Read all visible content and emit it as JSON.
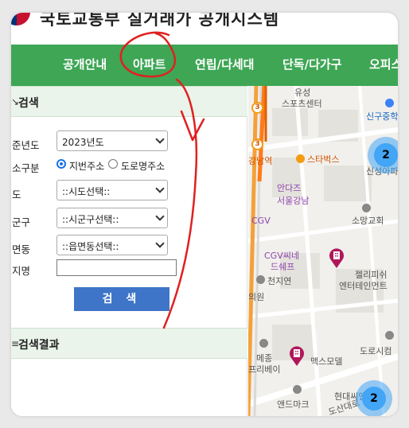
{
  "header": {
    "site_title": "국토교통부 실거래가 공개시스템"
  },
  "nav": {
    "items": [
      {
        "label": "공개안내"
      },
      {
        "label": "아파트"
      },
      {
        "label": "연립/다세대"
      },
      {
        "label": "단독/다가구"
      },
      {
        "label": "오피스"
      }
    ]
  },
  "search_panel": {
    "title": "검색",
    "year_label": "준년도",
    "year_value": "2023년도",
    "type_label": "소구분",
    "radio_lot": "지번주소",
    "radio_road": "도로명주소",
    "sido_label": "도",
    "sido_value": "::시도선택::",
    "sigungu_label": "군구",
    "sigungu_value": "::시군구선택::",
    "dong_label": "면동",
    "dong_value": "::읍면동선택::",
    "name_label": "지명",
    "name_value": "",
    "button": "검 색"
  },
  "results": {
    "title": "검색결과"
  },
  "map": {
    "labels": {
      "yuseong": "유성",
      "sports": "스포츠센터",
      "singu": "신구중학",
      "gangnam": "강남역",
      "starbucks": "스타벅스",
      "sinseong": "신성아파트",
      "antarctic1": "안다즈",
      "antarctic2": "서울강남",
      "somang": "소망교회",
      "cgv": "CGV",
      "cgv2a": "CGV씨네",
      "cgv2b": "드쉐프",
      "cheonjiyeon": "천지연",
      "uiwon": "의원",
      "jelly1": "젤리피쉬",
      "jelly2": "엔터테인먼트",
      "dorosi": "도로시컴",
      "mejong1": "메종",
      "mejong2": "프리베이",
      "max": "맥스모델",
      "hyundai": "현대씨앤캐",
      "andmark": "앤드마크",
      "dosandaero": "도산대로"
    },
    "clusters": [
      {
        "count": "2"
      },
      {
        "count": "2"
      }
    ],
    "metro": [
      "3",
      "3"
    ]
  },
  "colors": {
    "nav_green": "#3ea655",
    "button_blue": "#3f75c8",
    "section_bg": "#eaf4ea",
    "annotation_red": "#e02020"
  }
}
